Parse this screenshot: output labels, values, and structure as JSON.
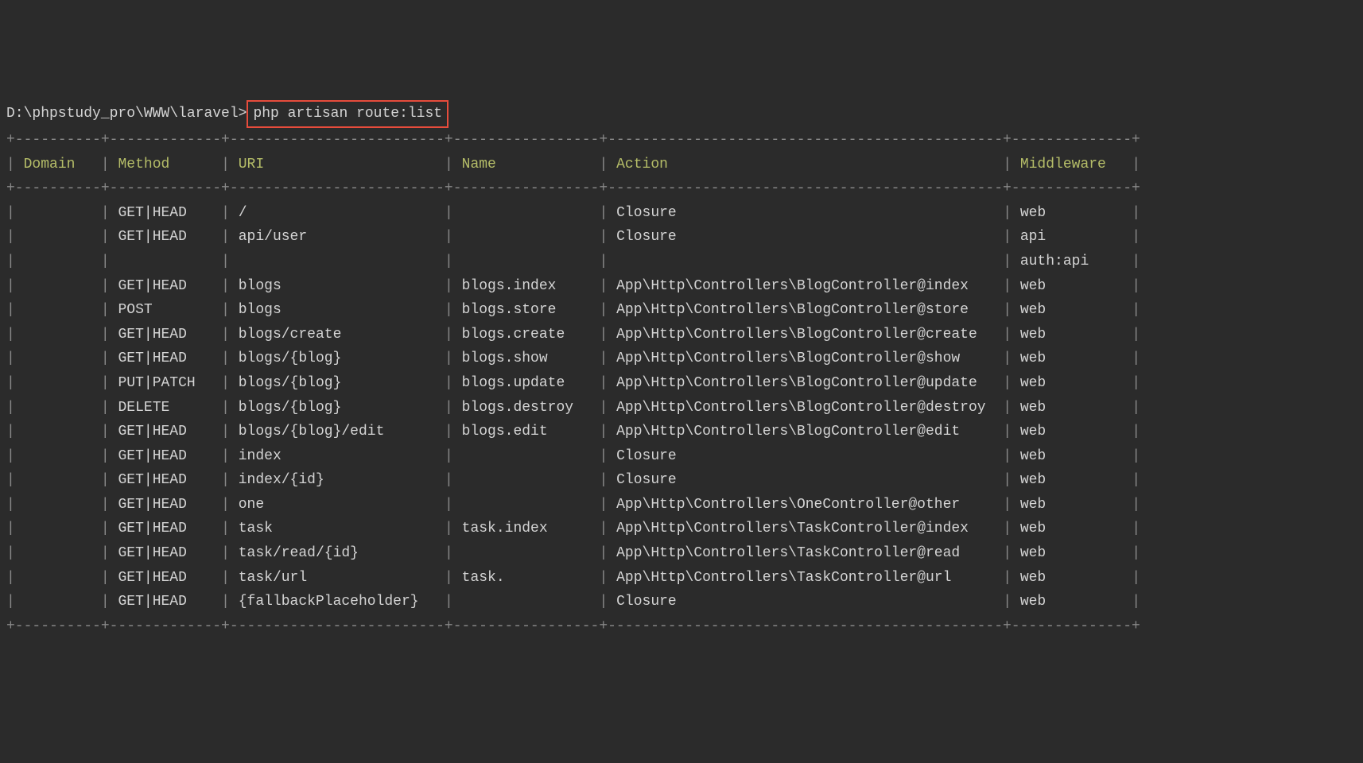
{
  "prompt": {
    "path": "D:\\phpstudy_pro\\WWW\\laravel>",
    "command": "php artisan route:list"
  },
  "headers": {
    "domain": "Domain",
    "method": "Method",
    "uri": "URI",
    "name": "Name",
    "action": "Action",
    "middleware": "Middleware"
  },
  "rows": [
    {
      "domain": "",
      "method": "GET|HEAD",
      "uri": "/",
      "name": "",
      "action": "Closure",
      "middleware": "web"
    },
    {
      "domain": "",
      "method": "GET|HEAD",
      "uri": "api/user",
      "name": "",
      "action": "Closure",
      "middleware": "api"
    },
    {
      "domain": "",
      "method": "",
      "uri": "",
      "name": "",
      "action": "",
      "middleware": "auth:api"
    },
    {
      "domain": "",
      "method": "GET|HEAD",
      "uri": "blogs",
      "name": "blogs.index",
      "action": "App\\Http\\Controllers\\BlogController@index",
      "middleware": "web"
    },
    {
      "domain": "",
      "method": "POST",
      "uri": "blogs",
      "name": "blogs.store",
      "action": "App\\Http\\Controllers\\BlogController@store",
      "middleware": "web"
    },
    {
      "domain": "",
      "method": "GET|HEAD",
      "uri": "blogs/create",
      "name": "blogs.create",
      "action": "App\\Http\\Controllers\\BlogController@create",
      "middleware": "web"
    },
    {
      "domain": "",
      "method": "GET|HEAD",
      "uri": "blogs/{blog}",
      "name": "blogs.show",
      "action": "App\\Http\\Controllers\\BlogController@show",
      "middleware": "web"
    },
    {
      "domain": "",
      "method": "PUT|PATCH",
      "uri": "blogs/{blog}",
      "name": "blogs.update",
      "action": "App\\Http\\Controllers\\BlogController@update",
      "middleware": "web"
    },
    {
      "domain": "",
      "method": "DELETE",
      "uri": "blogs/{blog}",
      "name": "blogs.destroy",
      "action": "App\\Http\\Controllers\\BlogController@destroy",
      "middleware": "web"
    },
    {
      "domain": "",
      "method": "GET|HEAD",
      "uri": "blogs/{blog}/edit",
      "name": "blogs.edit",
      "action": "App\\Http\\Controllers\\BlogController@edit",
      "middleware": "web"
    },
    {
      "domain": "",
      "method": "GET|HEAD",
      "uri": "index",
      "name": "",
      "action": "Closure",
      "middleware": "web"
    },
    {
      "domain": "",
      "method": "GET|HEAD",
      "uri": "index/{id}",
      "name": "",
      "action": "Closure",
      "middleware": "web"
    },
    {
      "domain": "",
      "method": "GET|HEAD",
      "uri": "one",
      "name": "",
      "action": "App\\Http\\Controllers\\OneController@other",
      "middleware": "web"
    },
    {
      "domain": "",
      "method": "GET|HEAD",
      "uri": "task",
      "name": "task.index",
      "action": "App\\Http\\Controllers\\TaskController@index",
      "middleware": "web"
    },
    {
      "domain": "",
      "method": "GET|HEAD",
      "uri": "task/read/{id}",
      "name": "",
      "action": "App\\Http\\Controllers\\TaskController@read",
      "middleware": "web"
    },
    {
      "domain": "",
      "method": "GET|HEAD",
      "uri": "task/url",
      "name": "task.",
      "action": "App\\Http\\Controllers\\TaskController@url",
      "middleware": "web"
    },
    {
      "domain": "",
      "method": "GET|HEAD",
      "uri": "{fallbackPlaceholder}",
      "name": "",
      "action": "Closure",
      "middleware": "web"
    }
  ],
  "widths": {
    "domain": 8,
    "method": 11,
    "uri": 23,
    "name": 15,
    "action": 44,
    "middleware": 12
  }
}
